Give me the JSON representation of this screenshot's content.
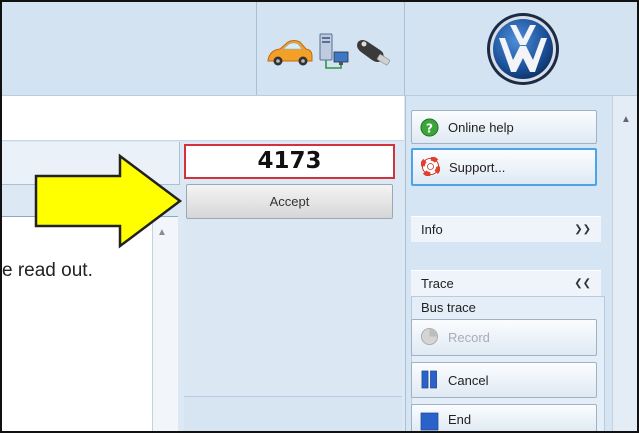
{
  "header": {
    "icons": [
      "car-icon",
      "network-icon",
      "key-icon"
    ],
    "logo": "vw-logo"
  },
  "main": {
    "code_value": "4173",
    "accept_label": "Accept",
    "readout_text": "e read out."
  },
  "annotation": {
    "arrow_color": "#ffff00"
  },
  "sidebar": {
    "online_help_label": "Online help",
    "support_label": "Support...",
    "info_label": "Info",
    "trace_label": "Trace",
    "bus_trace_label": "Bus trace",
    "record_label": "Record",
    "cancel_label": "Cancel",
    "end_label": "End"
  },
  "colors": {
    "code_border": "#d0343a",
    "accent_blue": "#4da3e6"
  }
}
